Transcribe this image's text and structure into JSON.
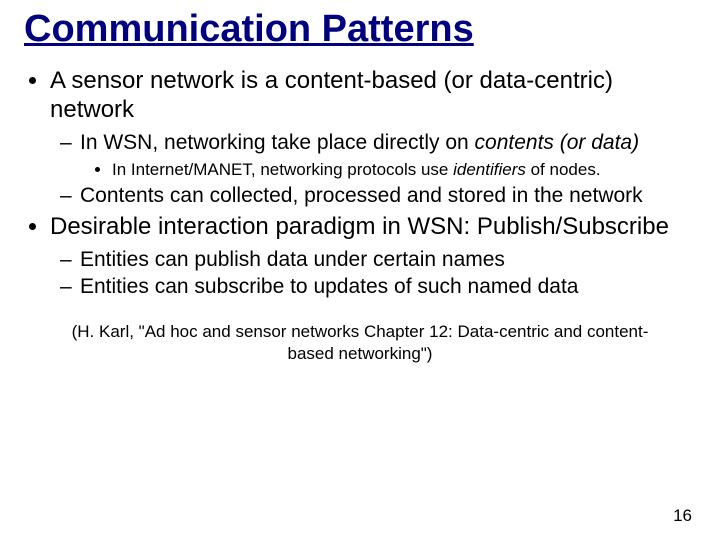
{
  "title": "Communication Patterns",
  "bullets": {
    "b1": "A sensor network is a content-based (or data-centric) network",
    "b1a_pre": "In WSN, networking take place directly on ",
    "b1a_em": "contents (or data)",
    "b1a_i_pre": "In Internet/MANET, networking protocols use ",
    "b1a_i_em": "identifiers",
    "b1a_i_post": " of nodes.",
    "b1b": "Contents can collected, processed and stored in the network",
    "b2": "Desirable interaction paradigm in WSN: Publish/Subscribe",
    "b2a": "Entities can publish data under certain names",
    "b2b": "Entities can subscribe to updates of such named data"
  },
  "citation": "(H. Karl, \"Ad hoc and sensor networks Chapter 12: Data-centric and content-based networking\")",
  "page_number": "16"
}
